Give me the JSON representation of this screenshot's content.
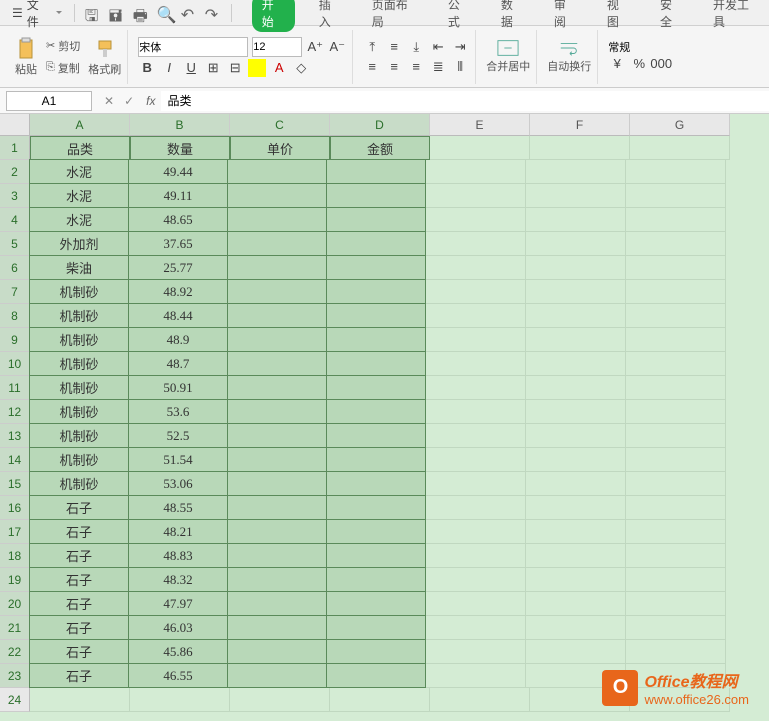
{
  "menu": {
    "file": "文件",
    "tabs": [
      "开始",
      "插入",
      "页面布局",
      "公式",
      "数据",
      "审阅",
      "视图",
      "安全",
      "开发工具"
    ],
    "active_tab": "开始"
  },
  "clipboard": {
    "paste": "粘贴",
    "cut": "剪切",
    "copy": "复制",
    "painter": "格式刷"
  },
  "font": {
    "name": "宋体",
    "size": "12"
  },
  "merge": {
    "label": "合并居中"
  },
  "wrap": {
    "label": "自动换行"
  },
  "number": {
    "format": "常规"
  },
  "namebox": "A1",
  "formula": "品类",
  "columns": [
    "A",
    "B",
    "C",
    "D",
    "E",
    "F",
    "G"
  ],
  "headers": [
    "品类",
    "数量",
    "单价",
    "金额"
  ],
  "chart_data": {
    "type": "table",
    "columns": [
      "品类",
      "数量",
      "单价",
      "金额"
    ],
    "rows": [
      {
        "品类": "水泥",
        "数量": 49.44,
        "单价": "",
        "金额": ""
      },
      {
        "品类": "水泥",
        "数量": 49.11,
        "单价": "",
        "金额": ""
      },
      {
        "品类": "水泥",
        "数量": 48.65,
        "单价": "",
        "金额": ""
      },
      {
        "品类": "外加剂",
        "数量": 37.65,
        "单价": "",
        "金额": ""
      },
      {
        "品类": "柴油",
        "数量": 25.77,
        "单价": "",
        "金额": ""
      },
      {
        "品类": "机制砂",
        "数量": 48.92,
        "单价": "",
        "金额": ""
      },
      {
        "品类": "机制砂",
        "数量": 48.44,
        "单价": "",
        "金额": ""
      },
      {
        "品类": "机制砂",
        "数量": 48.9,
        "单价": "",
        "金额": ""
      },
      {
        "品类": "机制砂",
        "数量": 48.7,
        "单价": "",
        "金额": ""
      },
      {
        "品类": "机制砂",
        "数量": 50.91,
        "单价": "",
        "金额": ""
      },
      {
        "品类": "机制砂",
        "数量": 53.6,
        "单价": "",
        "金额": ""
      },
      {
        "品类": "机制砂",
        "数量": 52.5,
        "单价": "",
        "金额": ""
      },
      {
        "品类": "机制砂",
        "数量": 51.54,
        "单价": "",
        "金额": ""
      },
      {
        "品类": "机制砂",
        "数量": 53.06,
        "单价": "",
        "金额": ""
      },
      {
        "品类": "石子",
        "数量": 48.55,
        "单价": "",
        "金额": ""
      },
      {
        "品类": "石子",
        "数量": 48.21,
        "单价": "",
        "金额": ""
      },
      {
        "品类": "石子",
        "数量": 48.83,
        "单价": "",
        "金额": ""
      },
      {
        "品类": "石子",
        "数量": 48.32,
        "单价": "",
        "金额": ""
      },
      {
        "品类": "石子",
        "数量": 47.97,
        "单价": "",
        "金额": ""
      },
      {
        "品类": "石子",
        "数量": 46.03,
        "单价": "",
        "金额": ""
      },
      {
        "品类": "石子",
        "数量": 45.86,
        "单价": "",
        "金额": ""
      },
      {
        "品类": "石子",
        "数量": 46.55,
        "单价": "",
        "金额": ""
      }
    ]
  },
  "watermark": {
    "title": "Office教程网",
    "url": "www.office26.com"
  }
}
